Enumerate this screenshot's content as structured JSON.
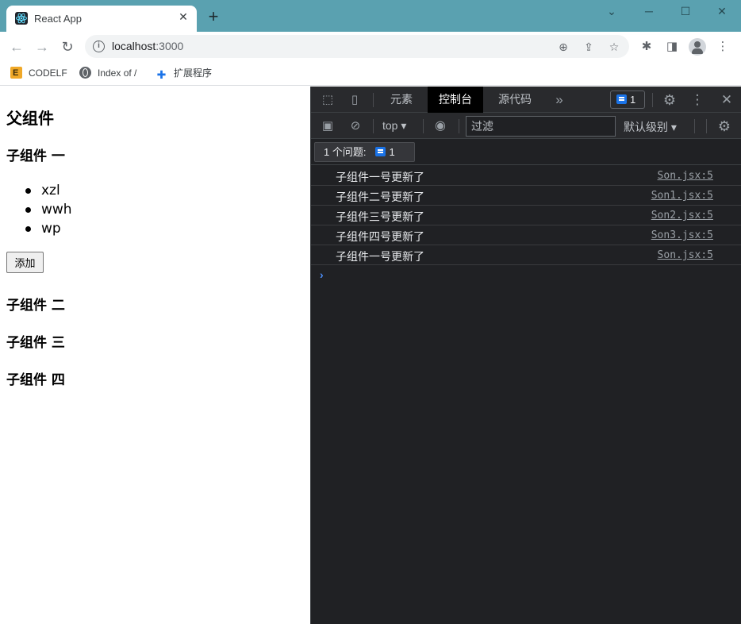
{
  "browser": {
    "tab_title": "React App",
    "tab_close": "✕",
    "new_tab": "+",
    "url_host": "localhost",
    "url_port": ":3000",
    "bookmarks": [
      {
        "label": "CODELF",
        "icon": "codelf-icon"
      },
      {
        "label": "Index of /",
        "icon": "globe-icon"
      },
      {
        "label": "扩展程序",
        "icon": "puzzle-icon"
      }
    ]
  },
  "page": {
    "parent_title": "父组件",
    "son1_title": "子组件 一",
    "list_items": [
      "xzl",
      "wwh",
      "wp"
    ],
    "add_button": "添加",
    "son2_title": "子组件 二",
    "son3_title": "子组件 三",
    "son4_title": "子组件 四"
  },
  "devtools": {
    "tabs": [
      "元素",
      "控制台",
      "源代码"
    ],
    "active_tab": "控制台",
    "more_tabs": "»",
    "issue_count": "1",
    "context": "top",
    "filter_placeholder": "过滤",
    "level": "默认级别",
    "issues_label": "1 个问题:",
    "issues_count": "1",
    "logs": [
      {
        "message": "子组件一号更新了",
        "source": "Son.jsx:5"
      },
      {
        "message": "子组件二号更新了",
        "source": "Son1.jsx:5"
      },
      {
        "message": "子组件三号更新了",
        "source": "Son2.jsx:5"
      },
      {
        "message": "子组件四号更新了",
        "source": "Son3.jsx:5"
      },
      {
        "message": "子组件一号更新了",
        "source": "Son.jsx:5"
      }
    ],
    "prompt": "›"
  },
  "colors": {
    "titlebar": "#5aa1b0",
    "devtools_bg": "#202124",
    "accent_blue": "#1a73e8"
  }
}
